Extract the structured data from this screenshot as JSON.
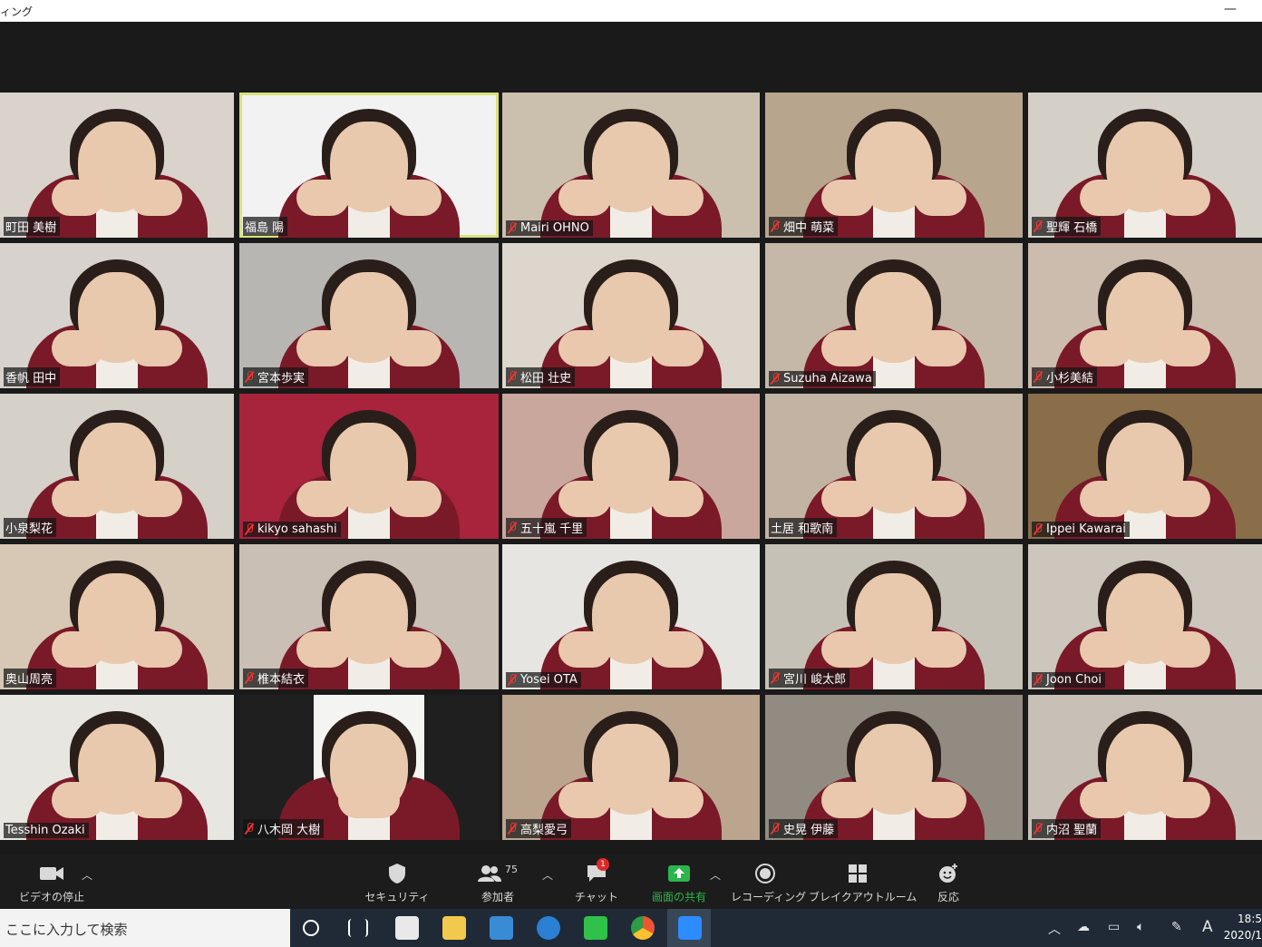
{
  "window": {
    "title": "ィング"
  },
  "colors": {
    "accent_active": "#d9e27a",
    "mute_red": "#e33333",
    "share_green": "#2cb54c",
    "chat_badge": "#e02828"
  },
  "participants": [
    {
      "name": "町田 美樹",
      "muted": false
    },
    {
      "name": "福島 陽",
      "muted": false,
      "active_speaker": true
    },
    {
      "name": "Mairi OHNO",
      "muted": true
    },
    {
      "name": "畑中 萌菜",
      "muted": true
    },
    {
      "name": "聖輝 石橋",
      "muted": true
    },
    {
      "name": "香帆 田中",
      "muted": false
    },
    {
      "name": "宮本歩実",
      "muted": true
    },
    {
      "name": "松田 壮史",
      "muted": true
    },
    {
      "name": "Suzuha Aizawa",
      "muted": true
    },
    {
      "name": "小杉美結",
      "muted": true
    },
    {
      "name": "小泉梨花",
      "muted": false
    },
    {
      "name": "kikyo sahashi",
      "muted": true
    },
    {
      "name": "五十嵐 千里",
      "muted": true
    },
    {
      "name": "土居 和歌南",
      "muted": false
    },
    {
      "name": "Ippei Kawarai",
      "muted": true
    },
    {
      "name": "奥山周亮",
      "muted": false
    },
    {
      "name": "椎本結衣",
      "muted": true
    },
    {
      "name": "Yosei OTA",
      "muted": true
    },
    {
      "name": "宮川 峻太郎",
      "muted": true
    },
    {
      "name": "Joon Choi",
      "muted": true
    },
    {
      "name": "Tesshin Ozaki",
      "muted": false
    },
    {
      "name": "八木岡 大樹",
      "muted": true
    },
    {
      "name": "高梨愛弓",
      "muted": true
    },
    {
      "name": "史晃 伊藤",
      "muted": true
    },
    {
      "name": "内沼 聖蘭",
      "muted": true
    }
  ],
  "controls": {
    "video_stop": "ビデオの停止",
    "security": "セキュリティ",
    "participants": "参加者",
    "participant_count": "75",
    "chat": "チャット",
    "chat_badge": "1",
    "share_screen": "画面の共有",
    "recording": "レコーディング",
    "breakout": "ブレイクアウトルーム",
    "reactions": "反応"
  },
  "taskbar": {
    "search_placeholder": "ここに入力して検索",
    "time": "18:5",
    "date": "2020/1",
    "ime": "A"
  }
}
